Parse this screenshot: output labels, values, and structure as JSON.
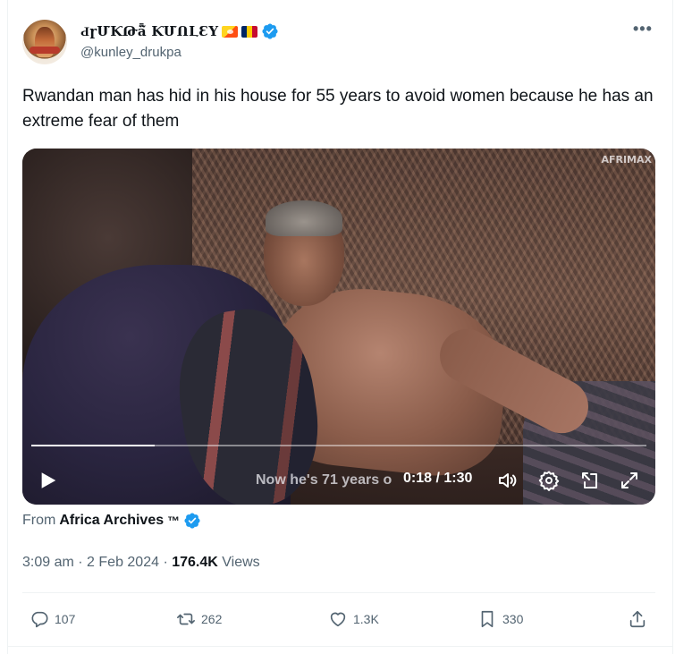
{
  "author": {
    "display_name": "ԀɼՄƘԹǟ̃ ƘՄՈԼƐY",
    "handle": "@kunley_drukpa"
  },
  "icons": {
    "verified": "verified-badge-icon",
    "flags": [
      "bhutan-flag-icon",
      "chad-flag-icon"
    ],
    "more": "more-options-icon"
  },
  "tweet": {
    "text": "Rwandan man has hid in his house for 55 years to avoid women because he has an extreme fear of them"
  },
  "video": {
    "watermark": "AFRIMAX",
    "subtitle": "Now he's 71 years o",
    "time": "0:18 / 1:30",
    "progress": 0.2
  },
  "source": {
    "prefix": "From",
    "name": "Africa Archives",
    "tm": "™"
  },
  "meta": {
    "time": "3:09 am",
    "date": "2 Feb 2024",
    "views_count": "176.4K",
    "views_label": "Views",
    "sep": "·"
  },
  "actions": {
    "replies": "107",
    "retweets": "262",
    "likes": "1.3K",
    "bookmarks": "330"
  },
  "colors": {
    "accent": "#1d9bf0",
    "secondary_text": "#536471",
    "primary_text": "#0f1419"
  }
}
